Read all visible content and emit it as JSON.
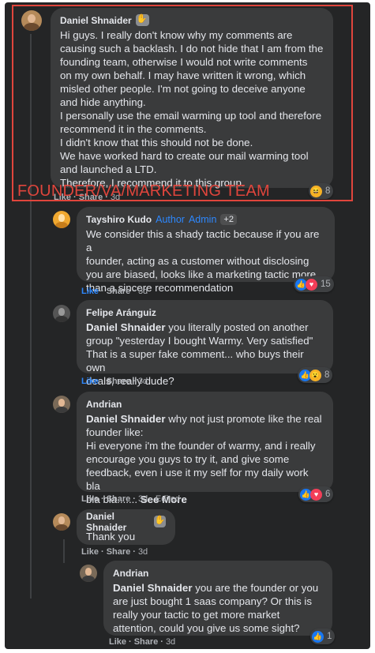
{
  "overlay": {
    "caption": "FOUNDER/VA/MARKETING TEAM"
  },
  "comments": [
    {
      "author": "Daniel Shnaider",
      "lines": [
        "Hi guys. I really don't know why my comments are",
        "causing such a backlash. I do not hide that I am from the",
        "founding team, otherwise I would not write comments",
        "on my own behalf. I may have written it wrong, which",
        "misled other people. I'm not going to deceive anyone",
        "and hide anything.",
        "I personally use the email warming up tool and therefore",
        "recommend it in the comments.",
        "I didn't know that this should not be done.",
        "We have worked hard to create our mail warming tool",
        "and launched a LTD.",
        "Therefore, I recommend it to this group."
      ],
      "actions": {
        "like": "Like",
        "share": "Share",
        "time": "3d"
      },
      "reaction_count": "8"
    },
    {
      "author": "Tayshiro Kudo",
      "tag_author": "Author",
      "tag_admin": "Admin",
      "extra_badges": "+2",
      "lines": [
        "We consider this a shady tactic because if you are a",
        "founder, acting as a customer without disclosing",
        "you are biased, looks like a marketing tactic more",
        "than a sincere recommendation"
      ],
      "actions": {
        "like": "Like",
        "share": "Share",
        "time": "3d"
      },
      "reaction_count": "15"
    },
    {
      "author": "Felipe Aránguiz",
      "mention": "Daniel Shnaider",
      "first_line_rest": " you literally posted on another",
      "lines": [
        "group \"yesterday I bought Warmy. Very satisfied\"",
        "That is a super fake comment... who buys their own",
        "deals, really dude?"
      ],
      "actions": {
        "like": "Like",
        "share": "Share",
        "time": "3d"
      },
      "reaction_count": "8"
    },
    {
      "author": "Andrian",
      "mention": "Daniel Shnaider",
      "first_line_rest": " why not just promote like the real",
      "lines": [
        "founder like:",
        "Hi everyone i'm the founder of warmy, and i really",
        "encourage you guys to try it, and give some",
        "feedback, even i use it my self for my daily work bla"
      ],
      "last_line": "bla bla....... ",
      "see_more": "See More",
      "actions": {
        "like": "Like",
        "share": "Share",
        "time": "3d",
        "edited": "Edited"
      },
      "reaction_count": "6"
    },
    {
      "author": "Daniel Shnaider",
      "lines": [
        "Thank you"
      ],
      "actions": {
        "like": "Like",
        "share": "Share",
        "time": "3d"
      }
    },
    {
      "author": "Andrian",
      "mention": "Daniel Shnaider",
      "first_line_rest": " you are the founder or you",
      "lines": [
        "are just bought 1 saas company? Or this is",
        "really your tactic to get more market",
        "attention, could you give us some sight?"
      ],
      "actions": {
        "like": "Like",
        "share": "Share",
        "time": "3d"
      },
      "reaction_count": "1"
    }
  ],
  "colors": {
    "panel_bg": "#242526",
    "bubble_bg": "#3a3b3c",
    "text": "#e4e6eb",
    "muted": "#b0b3b8",
    "link_blue": "#2d88ff",
    "highlight_red": "#e0453c"
  }
}
